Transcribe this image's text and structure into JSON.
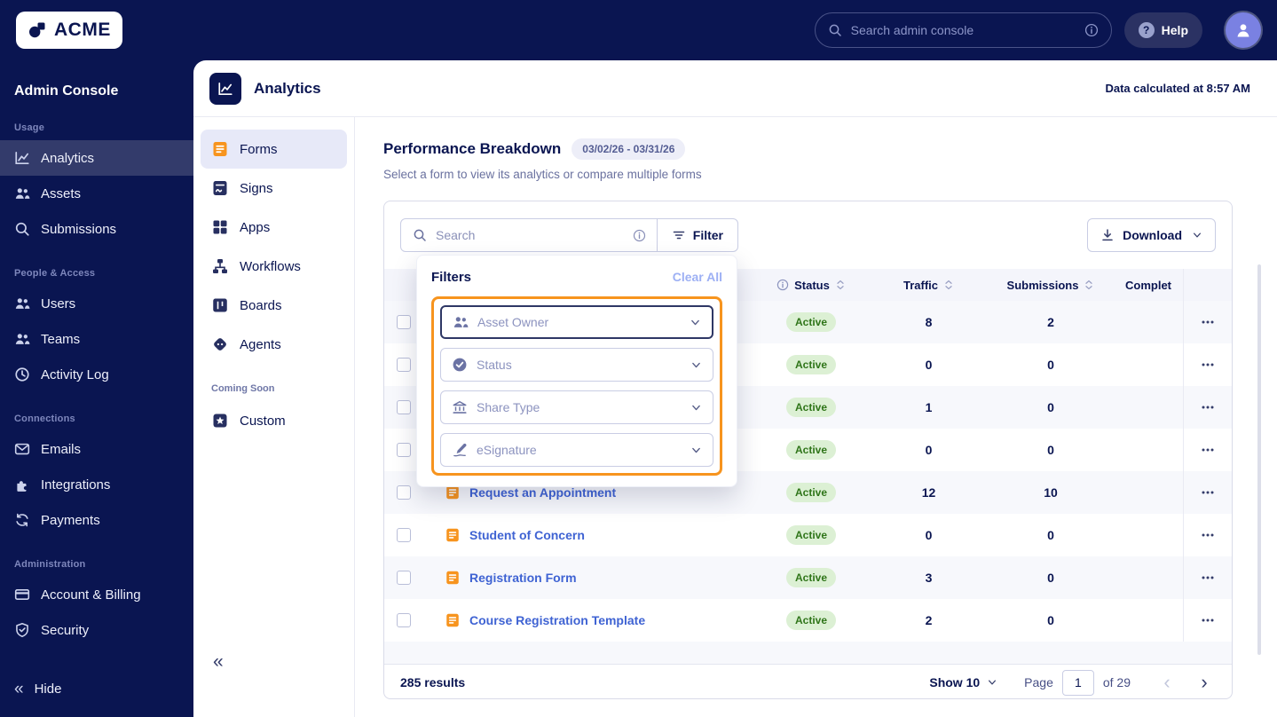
{
  "topbar": {
    "logo_text": "ACME",
    "search_placeholder": "Search admin console",
    "help_label": "Help"
  },
  "sidebar": {
    "title": "Admin Console",
    "hide_label": "Hide",
    "sections": [
      {
        "label": "Usage",
        "items": [
          {
            "label": "Analytics",
            "icon": "chart-line",
            "active": true
          },
          {
            "label": "Assets",
            "icon": "people"
          },
          {
            "label": "Submissions",
            "icon": "search"
          }
        ]
      },
      {
        "label": "People & Access",
        "items": [
          {
            "label": "Users",
            "icon": "people"
          },
          {
            "label": "Teams",
            "icon": "people"
          },
          {
            "label": "Activity Log",
            "icon": "clock"
          }
        ]
      },
      {
        "label": "Connections",
        "items": [
          {
            "label": "Emails",
            "icon": "mail"
          },
          {
            "label": "Integrations",
            "icon": "puzzle"
          },
          {
            "label": "Payments",
            "icon": "refresh"
          }
        ]
      },
      {
        "label": "Administration",
        "items": [
          {
            "label": "Account & Billing",
            "icon": "card"
          },
          {
            "label": "Security",
            "icon": "shield"
          }
        ]
      }
    ]
  },
  "card_header": {
    "title": "Analytics",
    "note": "Data calculated at 8:57 AM"
  },
  "subnav": {
    "items": [
      {
        "label": "Forms",
        "icon": "doc-lines",
        "active": true
      },
      {
        "label": "Signs",
        "icon": "sign-doc"
      },
      {
        "label": "Apps",
        "icon": "apps-grid"
      },
      {
        "label": "Workflows",
        "icon": "workflow"
      },
      {
        "label": "Boards",
        "icon": "boards"
      },
      {
        "label": "Agents",
        "icon": "agent"
      }
    ],
    "coming_soon_label": "Coming Soon",
    "coming_soon_items": [
      {
        "label": "Custom",
        "icon": "custom"
      }
    ]
  },
  "main": {
    "title": "Performance Breakdown",
    "date_range": "03/02/26 - 03/31/26",
    "subtitle": "Select a form to view its analytics or compare multiple forms"
  },
  "toolbar": {
    "search_placeholder": "Search",
    "filter_label": "Filter",
    "download_label": "Download"
  },
  "filters": {
    "title": "Filters",
    "clear_all": "Clear All",
    "fields": [
      {
        "label": "Asset Owner",
        "icon": "people"
      },
      {
        "label": "Status",
        "icon": "check-circle"
      },
      {
        "label": "Share Type",
        "icon": "bank"
      },
      {
        "label": "eSignature",
        "icon": "pen"
      }
    ]
  },
  "table": {
    "columns": {
      "status": "Status",
      "traffic": "Traffic",
      "submissions": "Submissions",
      "completion": "Complet"
    },
    "rows": [
      {
        "name": "",
        "status": "Active",
        "traffic": "8",
        "submissions": "2"
      },
      {
        "name": "",
        "status": "Active",
        "traffic": "0",
        "submissions": "0"
      },
      {
        "name": "",
        "status": "Active",
        "traffic": "1",
        "submissions": "0"
      },
      {
        "name": "",
        "status": "Active",
        "traffic": "0",
        "submissions": "0"
      },
      {
        "name": "Request an Appointment",
        "status": "Active",
        "traffic": "12",
        "submissions": "10"
      },
      {
        "name": "Student of Concern",
        "status": "Active",
        "traffic": "0",
        "submissions": "0"
      },
      {
        "name": "Registration Form",
        "status": "Active",
        "traffic": "3",
        "submissions": "0"
      },
      {
        "name": "Course Registration Template",
        "status": "Active",
        "traffic": "2",
        "submissions": "0"
      }
    ]
  },
  "footer": {
    "results": "285 results",
    "show_label": "Show 10",
    "page_label": "Page",
    "page_value": "1",
    "of_label": "of 29"
  }
}
